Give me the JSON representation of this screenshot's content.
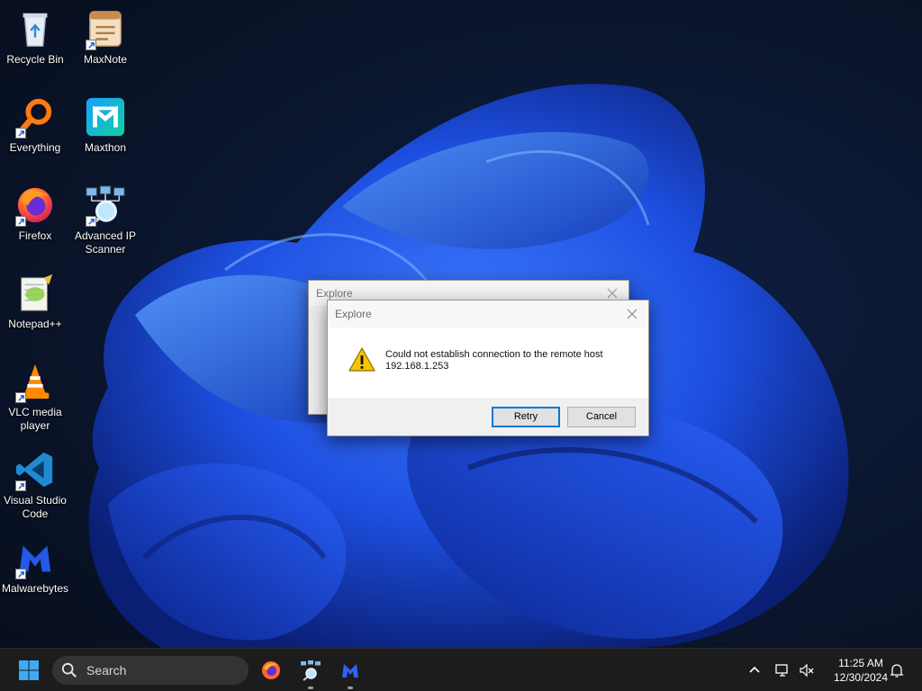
{
  "desktop": {
    "icons": [
      {
        "label": "Recycle Bin",
        "icon": "recycle-bin-icon"
      },
      {
        "label": "MaxNote",
        "icon": "maxnote-icon"
      },
      {
        "label": "Everything",
        "icon": "everything-icon"
      },
      {
        "label": "Maxthon",
        "icon": "maxthon-icon"
      },
      {
        "label": "Firefox",
        "icon": "firefox-icon"
      },
      {
        "label": "Advanced IP Scanner",
        "icon": "advanced-ip-scanner-icon"
      },
      {
        "label": "Notepad++",
        "icon": "notepad-plus-plus-icon"
      },
      {
        "label": "VLC media player",
        "icon": "vlc-icon"
      },
      {
        "label": "Visual Studio Code",
        "icon": "vscode-icon"
      },
      {
        "label": "Malwarebytes",
        "icon": "malwarebytes-icon"
      }
    ]
  },
  "dialog_back": {
    "title": "Explore"
  },
  "dialog": {
    "title": "Explore",
    "message_line1": "Could not establish connection to the remote host",
    "message_line2": "192.168.1.253",
    "retry_label": "Retry",
    "cancel_label": "Cancel"
  },
  "taskbar": {
    "search_placeholder": "Search",
    "time": "11:25 AM",
    "date": "12/30/2024",
    "pinned": [
      "firefox-icon",
      "advanced-ip-scanner-icon",
      "malwarebytes-icon"
    ]
  },
  "colors": {
    "accent": "#0078d7",
    "taskbar_bg": "#1c1c1c",
    "wallpaper_blue": "#1f4fe0"
  }
}
